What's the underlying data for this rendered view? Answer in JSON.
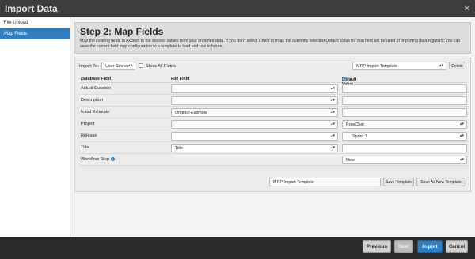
{
  "window": {
    "title": "Import Data",
    "close_glyph": "×"
  },
  "sidebar": {
    "items": [
      {
        "label": "File Upload",
        "active": false
      },
      {
        "label": "Map Fields",
        "active": true
      }
    ]
  },
  "step": {
    "title": "Step 2: Map Fields",
    "description": "Map the existing fields in Axosoft to the desired values from your imported data. If you don't select a field to map, the currently selected Default Value for that field will be used. If importing data regularly, you can save the current field map configuration to a template to load and use in future."
  },
  "controls": {
    "import_to_label": "Import To:",
    "import_to_value": "User Stories",
    "show_all_label": "Show All Fields",
    "template_select_value": "MRP Import Template",
    "delete_label": "Delete"
  },
  "grid": {
    "headers": {
      "database": "Database Field",
      "file": "File Field",
      "default": "Default Value"
    },
    "rows": [
      {
        "name": "Actual Duration",
        "file_value": "",
        "default_value": "",
        "default_type": "text"
      },
      {
        "name": "Description",
        "file_value": "",
        "default_value": "",
        "default_type": "text"
      },
      {
        "name": "Initial Estimate",
        "file_value": "Original Estimate",
        "default_value": "",
        "default_type": "text"
      },
      {
        "name": "Project",
        "file_value": "",
        "default_value": "PureChat",
        "default_type": "select"
      },
      {
        "name": "Release",
        "file_value": "",
        "default_value": "Sprint 1",
        "default_type": "select"
      },
      {
        "name": "Title",
        "file_value": "Title",
        "default_value": "",
        "default_type": "text"
      },
      {
        "name": "Workflow Step",
        "file_value": "",
        "default_value": "New",
        "default_type": "select"
      }
    ]
  },
  "template": {
    "name_value": "MRP Import Template",
    "save_label": "Save Template",
    "save_as_new_label": "Save As New Template"
  },
  "footer": {
    "previous_label": "Previous",
    "next_label": "Next",
    "import_label": "Import",
    "cancel_label": "Cancel"
  },
  "icons": {
    "info": "info-icon",
    "dropdown": "updown-arrow-icon",
    "close": "close-icon"
  },
  "colors": {
    "accent": "#2d7fc1",
    "background": "#2b2b2b"
  }
}
